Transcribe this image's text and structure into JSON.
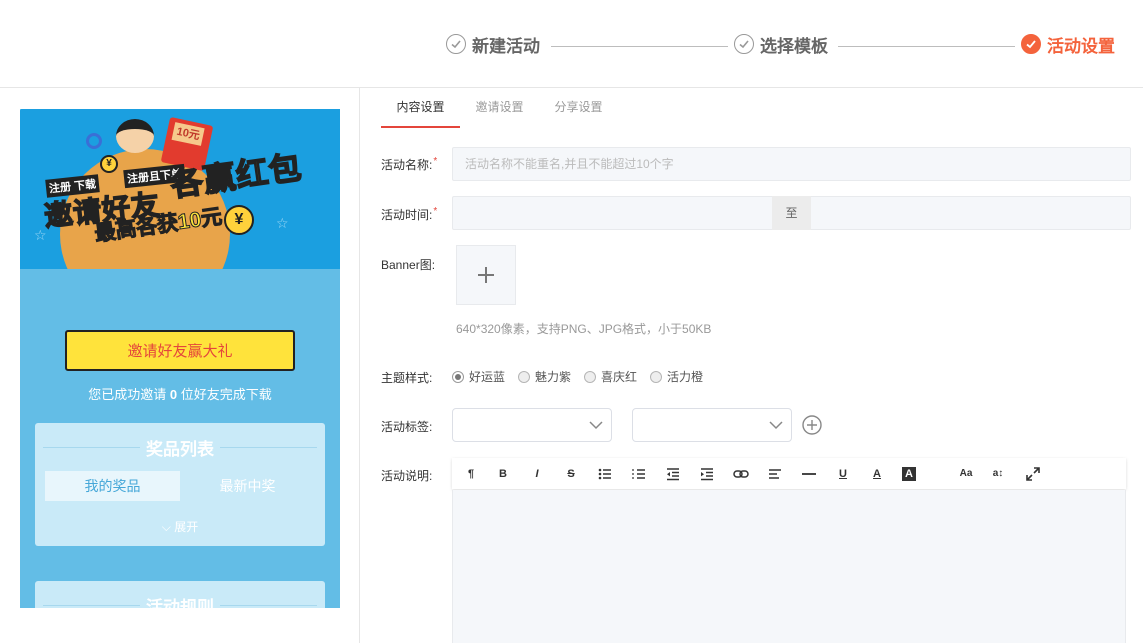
{
  "steps": [
    {
      "label": "新建活动",
      "state": "done"
    },
    {
      "label": "选择模板",
      "state": "done"
    },
    {
      "label": "活动设置",
      "state": "active"
    }
  ],
  "colors": {
    "accent": "#f4633c",
    "tab_underline": "#e4453b",
    "preview_bg": "#63bde6",
    "button_yellow": "#ffe33b"
  },
  "preview": {
    "banner": {
      "small_text_1": "注册",
      "small_text_2": "下载",
      "small_text_3": "注册且下单",
      "main_text": "邀请好友",
      "main_text_2": "各赢红包",
      "sub_text": "最高各获10元",
      "envelope_text": "10元",
      "coin_symbol": "¥"
    },
    "invite_button": "邀请好友赢大礼",
    "status_prefix": "您已成功邀请 ",
    "status_count": "0",
    "status_suffix": " 位好友完成下载",
    "prize_title": "奖品列表",
    "prize_tabs": [
      "我的奖品",
      "最新中奖"
    ],
    "expand_label": "展开",
    "rules_title": "活动规则"
  },
  "tabs": [
    {
      "label": "内容设置",
      "active": true
    },
    {
      "label": "邀请设置",
      "active": false
    },
    {
      "label": "分享设置",
      "active": false
    }
  ],
  "form": {
    "name_label": "活动名称:",
    "name_placeholder": "活动名称不能重名,并且不能超过10个字",
    "time_label": "活动时间:",
    "time_separator": "至",
    "banner_label": "Banner图:",
    "banner_hint": "640*320像素，支持PNG、JPG格式，小于50KB",
    "theme_label": "主题样式:",
    "themes": [
      {
        "label": "好运蓝",
        "selected": true
      },
      {
        "label": "魅力紫",
        "selected": false
      },
      {
        "label": "喜庆红",
        "selected": false
      },
      {
        "label": "活力橙",
        "selected": false
      }
    ],
    "tag_label": "活动标签:",
    "desc_label": "活动说明:",
    "required_mark": "*"
  },
  "toolbar": [
    {
      "icon": "paragraph-icon",
      "glyph": "¶"
    },
    {
      "icon": "bold-icon",
      "glyph": "B"
    },
    {
      "icon": "italic-icon",
      "glyph": "I"
    },
    {
      "icon": "strikethrough-icon",
      "glyph": "S"
    },
    {
      "icon": "bullet-list-icon",
      "glyph": ""
    },
    {
      "icon": "ordered-list-icon",
      "glyph": ""
    },
    {
      "icon": "outdent-icon",
      "glyph": ""
    },
    {
      "icon": "indent-icon",
      "glyph": ""
    },
    {
      "icon": "link-icon",
      "glyph": ""
    },
    {
      "icon": "align-left-icon",
      "glyph": ""
    },
    {
      "icon": "horizontal-rule-icon",
      "glyph": ""
    },
    {
      "icon": "underline-icon",
      "glyph": "U"
    },
    {
      "icon": "font-color-icon",
      "glyph": "A"
    },
    {
      "icon": "background-color-icon",
      "glyph": "A"
    },
    {
      "icon": "font-size-icon",
      "glyph": "Aa"
    },
    {
      "icon": "line-height-icon",
      "glyph": "a↕"
    },
    {
      "icon": "fullscreen-icon",
      "glyph": ""
    }
  ]
}
